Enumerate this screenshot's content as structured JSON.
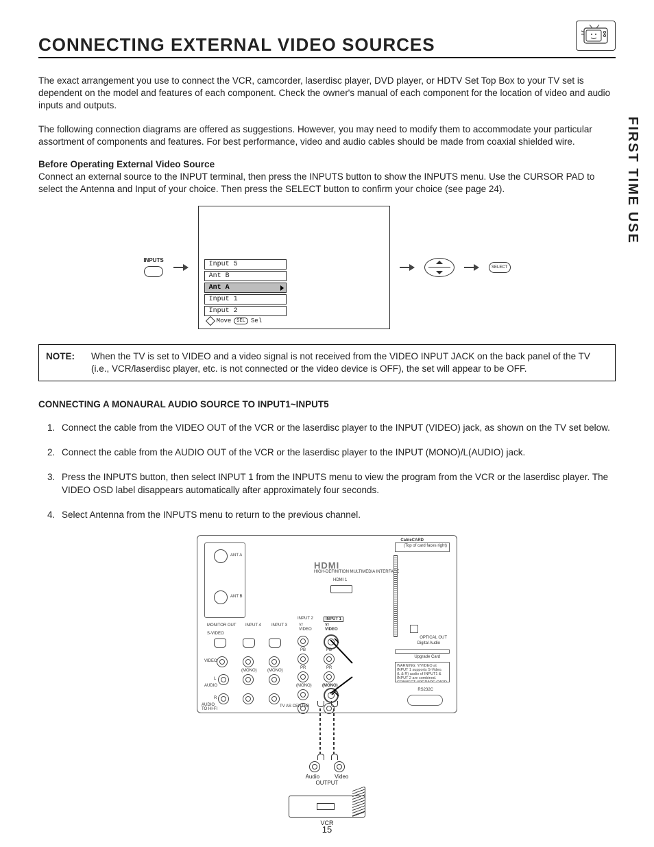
{
  "sideTab": "FIRST TIME USE",
  "title": "CONNECTING EXTERNAL VIDEO SOURCES",
  "intro1": "The exact arrangement you use to connect the VCR, camcorder, laserdisc player, DVD player, or HDTV Set Top Box to your TV set is dependent on the model and features of each component.  Check the owner's manual of each component for the location of video and audio inputs and outputs.",
  "intro2": "The following connection diagrams are offered as suggestions.  However, you may need to modify them to accommodate your particular assortment of components and features.  For best performance, video and audio cables should be made from coaxial shielded wire.",
  "subhead1": "Before Operating External Video Source",
  "subhead1Text": "Connect an external source to the INPUT terminal, then press the INPUTS button to show the INPUTS menu.  Use the CURSOR PAD to select the Antenna and Input of your choice.  Then press the SELECT button to confirm your choice (see page 24).",
  "inputsBtnLabel": "INPUTS",
  "osd": {
    "items": [
      "Input 5",
      "Ant B",
      "Ant A",
      "Input 1",
      "Input 2"
    ],
    "selectedIndex": 2,
    "footerMove": "Move",
    "footerSel": "SEL",
    "footerSelWord": "Sel"
  },
  "selectBtn": "SELECT",
  "note": {
    "label": "NOTE:",
    "text": "When the TV is set to VIDEO and a video signal is not received from the VIDEO INPUT JACK on the back panel of the TV (i.e., VCR/laserdisc player, etc. is not connected or the video device is OFF), the set will appear to be OFF."
  },
  "section2Head": "CONNECTING A MONAURAL AUDIO SOURCE TO INPUT1~INPUT5",
  "steps": [
    "Connect the cable from the VIDEO OUT of the VCR or the laserdisc player to the INPUT (VIDEO) jack, as shown on the TV set below.",
    "Connect the cable from the AUDIO OUT of the VCR or the laserdisc player to the INPUT (MONO)/L(AUDIO) jack.",
    "Press the INPUTS button, then select INPUT 1 from the INPUTS menu to view the program from the VCR or the laserdisc player.  The VIDEO OSD label disappears automatically after approximately four seconds.",
    "Select Antenna from the INPUTS menu to return to the previous channel."
  ],
  "panel": {
    "antA": "ANT A",
    "antB": "ANT B",
    "hdmiLogo": "HDMI",
    "hdmi1": "HDMI 1",
    "input1": "INPUT 1",
    "input2": "INPUT 2",
    "input3": "INPUT 3",
    "input4": "INPUT 4",
    "monitorOut": "MONITOR OUT",
    "svideo": "S-VIDEO",
    "yvideo": "Y/\nVIDEO",
    "pb": "PB",
    "pr": "PR",
    "video": "VIDEO",
    "mono": "(MONO)",
    "audio": "AUDIO",
    "l": "L",
    "r": "R",
    "toHifi": "AUDIO\nTO HI-FI",
    "tvAsCenter": "TV AS CENTER",
    "cableCard": "CableCARD",
    "cableCardSub": "(Top of card faces right)",
    "opticalOut": "OPTICAL OUT",
    "digitalAudio": "Digital Audio",
    "upgradeCard": "Upgrade Card",
    "warning": "WARNING: Y/VIDEO at INPUT 1 supports S-Video.\n(L & R) audio of INPUT1 & INPUT 2 are combined.\nCONNECT UPGRADE CARD BY FIRST RELEASING\nthe interlock switching device here.",
    "rs232c": "RS232C"
  },
  "av": {
    "audio": "Audio",
    "video": "Video",
    "output": "OUTPUT"
  },
  "vcrLabel": "VCR",
  "pageNumber": "15"
}
